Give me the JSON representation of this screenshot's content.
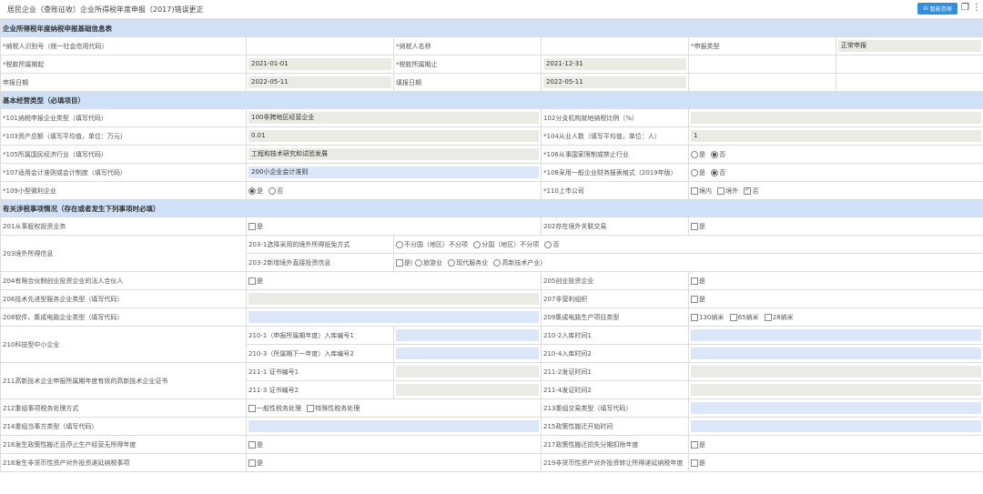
{
  "window": {
    "title": "居民企业（查账征收）企业所得税年度申报（2017)错误更正",
    "smart_btn": "智能咨询"
  },
  "sections": {
    "basic_info": "企业所得税年度纳税申报基础信息表",
    "basic_ops": "基本经营类型（必填项目）",
    "tax_items": "有关涉税事项情况（存在或者发生下列事项时必填）"
  },
  "basic": {
    "taxpayer_id_label": "*纳税人识别号（统一社会信用代码）",
    "taxpayer_name_label": "*纳税人名称",
    "decl_type_label": "*申报类型",
    "decl_type_value": "正常申报",
    "period_start_label": "*税款所属期起",
    "period_start_value": "2021-01-01",
    "period_end_label": "*税款所属期止",
    "period_end_value": "2021-12-31",
    "decl_date_label": "申报日期",
    "decl_date_value": "2022-05-11",
    "fill_date_label": "填报日期",
    "fill_date_value": "2022-05-11"
  },
  "ops": {
    "r101_label": "*101纳税申报企业类型（填写代码）",
    "r101_value": "100非跨地区经营企业",
    "r102_label": "102分支机构就地纳税比例（%）",
    "r103_label": "*103资产总额（填写平均值，单位：万元）",
    "r103_value": "0.01",
    "r104_label": "*104从业人数（填写平均值，单位：人）",
    "r104_value": "1",
    "r105_label": "*105所属国民经济行业（填写代码）",
    "r105_value": "工程和技术研究和试验发展",
    "r106_label": "*106从事国家限制或禁止行业",
    "r107_label": "*107适用会计准则或会计制度（填写代码）",
    "r107_value": "200小企业会计准则",
    "r108_label": "*108采用一般企业财务报表格式（2019年版）",
    "r109_label": "*109小型微利企业",
    "r110_label": "*110上市公司",
    "yes": "是",
    "no": "否",
    "domestic": "境内",
    "overseas": "境外"
  },
  "items": {
    "r201": "201从事股权投资业务",
    "r202": "202存在境外关联交易",
    "r203": "203境外所得信息",
    "r203_1": "203-1选择采用的境外所得抵免方式",
    "r203_1_opt1": "不分国（地区）不分项",
    "r203_1_opt2": "分国（地区）不分项",
    "r203_2": "203-2新增境外直接投资信息",
    "r203_2_yes": "是(",
    "r203_2_opt1": "旅游业",
    "r203_2_opt2": "现代服务业",
    "r203_2_opt3": "高新技术产业)",
    "r204": "204有限合伙制创业投资企业的法人合伙人",
    "r205": "205创业投资企业",
    "r206": "206技术先进型服务企业类型（填写代码）",
    "r207": "207非营利组织",
    "r208": "208软件、集成电路企业类型（填写代码）",
    "r209": "209集成电路生产项目类型",
    "r209_opt1": "130纳米",
    "r209_opt2": "65纳米",
    "r209_opt3": "28纳米",
    "r210": "210科技型中小企业",
    "r210_1": "210-1（申报所属期年度）入库编号1",
    "r210_2": "210-2入库时间1",
    "r210_3": "210-3（所属期下一年度）入库编号2",
    "r210_4": "210-4入库时间2",
    "r211": "211高新技术企业申报所属期年度有效的高新技术企业证书",
    "r211_1": "211-1 证书编号1",
    "r211_2": "211-2发证时间1",
    "r211_3": "211-3 证书编号2",
    "r211_4": "211-4发证时间2",
    "r212": "212重组事项税务处理方式",
    "r212_opt1": "一般性税务处理",
    "r212_opt2": "特殊性税务处理",
    "r213": "213重组交易类型（填写代码）",
    "r214": "214重组当事方类型（填写代码）",
    "r215": "215政策性搬迁开始时间",
    "r216": "216发生政策性搬迁且停止生产经营无所得年度",
    "r217": "217政策性搬迁损失分期扣除年度",
    "r218": "218发生非货币性资产对外投资递延纳税事项",
    "r219": "219非货币性资产对外投资转让所得递延纳税年度",
    "yes": "是"
  }
}
